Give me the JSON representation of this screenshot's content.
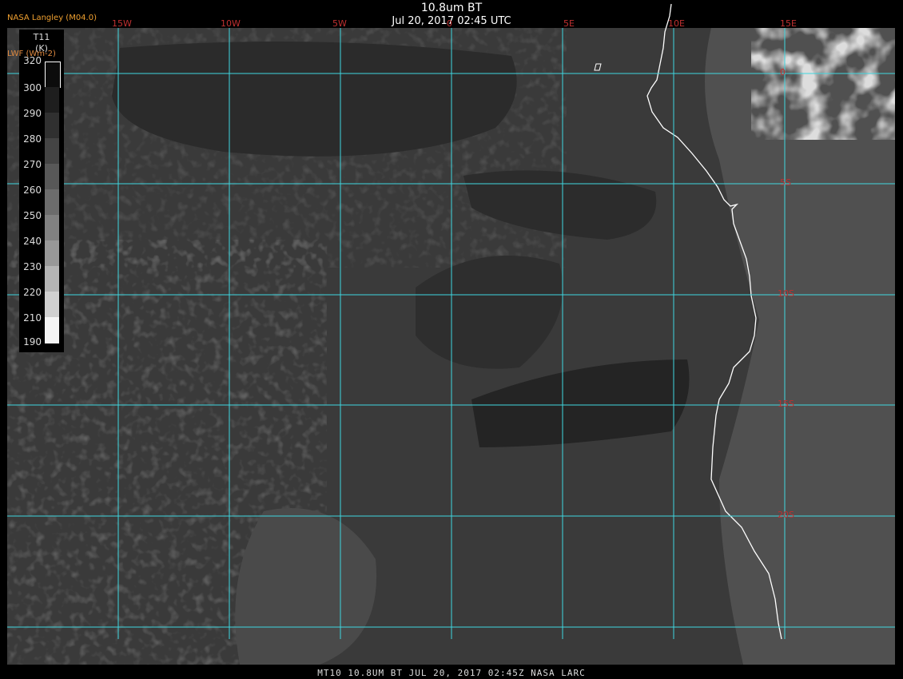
{
  "header": {
    "title": "10.8um BT",
    "datetime": "Jul 20, 2017 02:45 UTC",
    "provider": "NASA Langley (M04.0)",
    "lwf_label": "LWF (Wm-2)"
  },
  "legend": {
    "title_line1": "T11",
    "title_line2": "(K)",
    "ticks": [
      "320",
      "300",
      "290",
      "280",
      "270",
      "260",
      "250",
      "240",
      "230",
      "220",
      "210",
      "190"
    ]
  },
  "graticule": {
    "lon_labels": [
      "15W",
      "10W",
      "5W",
      "0",
      "5E",
      "10E",
      "15E"
    ],
    "lat_labels": [
      "0",
      "5S",
      "10S",
      "15S",
      "20S"
    ]
  },
  "footer": {
    "text": "MT10  10.8UM BT   JUL 20, 2017 02:45Z   NASA LARC"
  },
  "colors": {
    "gridline": "#3fd7e0",
    "grid_label": "#c03030",
    "coastline": "#ffffff",
    "ocean_gray": "#3a3a3a",
    "stratocumulus_gray": "#2a2a2a",
    "land_gray": "#555555"
  }
}
